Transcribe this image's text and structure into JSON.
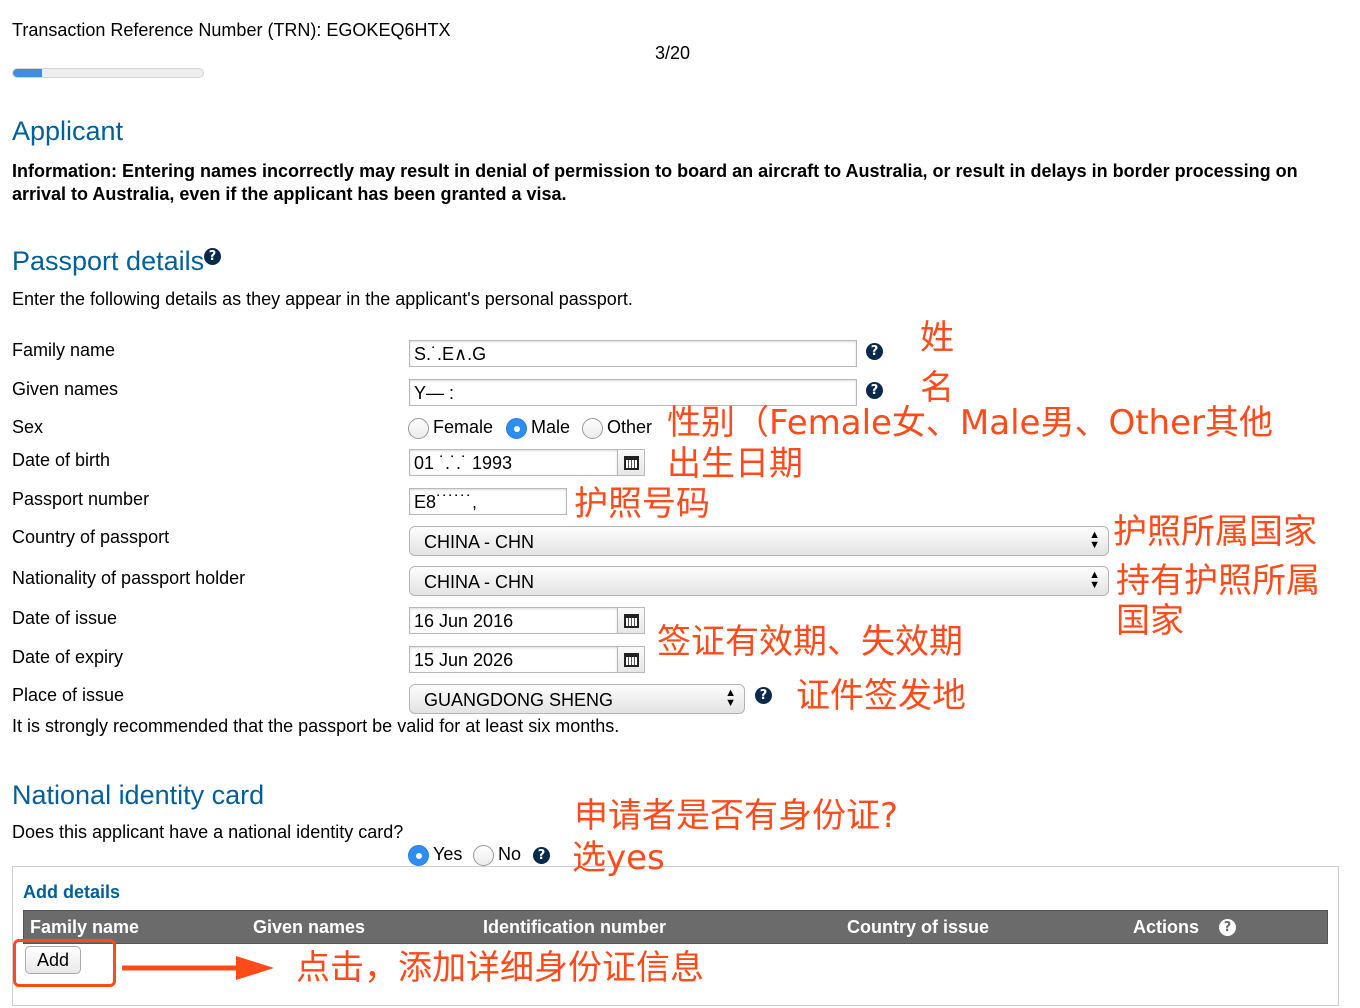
{
  "header": {
    "trn": "Transaction Reference Number (TRN): EGOKEQ6HTX",
    "step": "3/20",
    "progress_fraction": 0.15
  },
  "applicant": {
    "title": "Applicant",
    "info": "Information: Entering names incorrectly may result in denial of permission to board an aircraft to Australia, or result in delays in border processing on arrival to Australia, even if the applicant has been granted a visa."
  },
  "passport": {
    "title": "Passport details",
    "help_icon": "question-circle-icon",
    "intro": "Enter the following details as they appear in the applicant's personal passport.",
    "family_name_label": "Family name",
    "family_name_value": "S.˙.E∧.G",
    "given_names_label": "Given names",
    "given_names_value": "Y—   :",
    "sex_label": "Sex",
    "sex_options": [
      "Female",
      "Male",
      "Other"
    ],
    "sex_selected": "Male",
    "dob_label": "Date of birth",
    "dob_value": "01 ˙.˙.˙ 1993",
    "passport_number_label": "Passport number",
    "passport_number_value": "E8˙˙˙˙˙˙,",
    "country_label": "Country of passport",
    "country_value": "CHINA - CHN",
    "nationality_label": "Nationality of passport holder",
    "nationality_value": "CHINA - CHN",
    "issue_label": "Date of issue",
    "issue_value": "16 Jun 2016",
    "expiry_label": "Date of expiry",
    "expiry_value": "15 Jun 2026",
    "place_label": "Place of issue",
    "place_value": "GUANGDONG SHENG",
    "validity_note": "It is strongly recommended that the passport be valid for at least six months."
  },
  "national_id": {
    "title": "National identity card",
    "question": "Does this applicant have a national identity card?",
    "options": [
      "Yes",
      "No"
    ],
    "selected": "Yes",
    "add_details": "Add details",
    "columns": [
      "Family name",
      "Given names",
      "Identification number",
      "Country of issue",
      "Actions"
    ],
    "add_button": "Add"
  },
  "annotations": {
    "family": "姓",
    "given": "名",
    "sex": "性别（Female女、Male男、Other其他",
    "dob": "出生日期",
    "passport_no": "护照号码",
    "country": "护照所属国家",
    "nationality_line1": "持有护照所属",
    "nationality_line2": "国家",
    "dates": "签证有效期、失效期",
    "place": "证件签发地",
    "id_question": "申请者是否有身份证?",
    "id_choose": "选yes",
    "add_hint": "点击，添加详细身份证信息",
    "color": "#ff4a1a"
  }
}
